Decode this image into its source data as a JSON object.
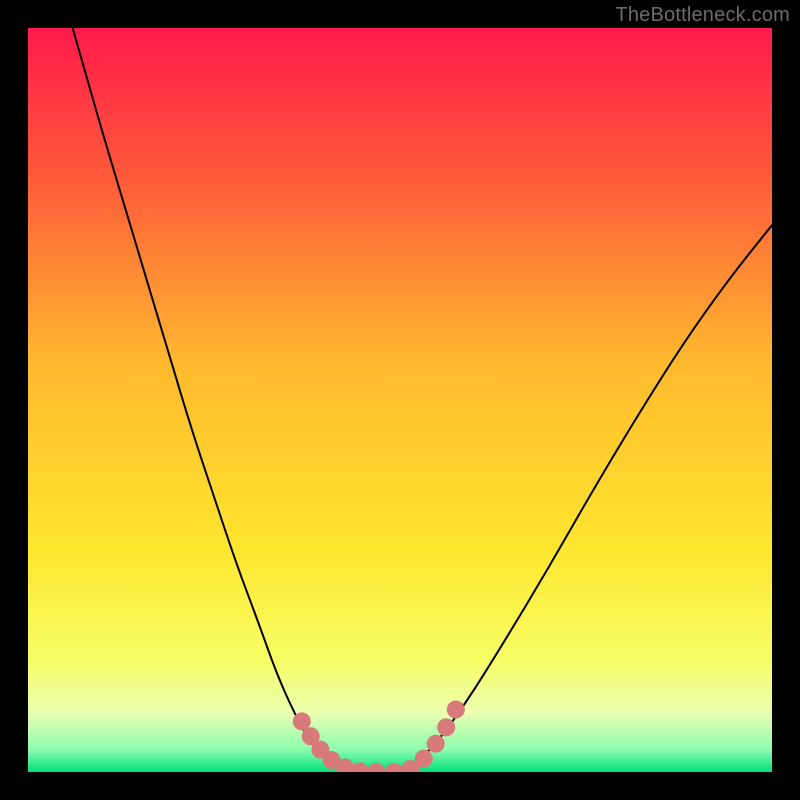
{
  "watermark": "TheBottleneck.com",
  "chart_data": {
    "type": "line",
    "title": "",
    "xlabel": "",
    "ylabel": "",
    "xlim": [
      0,
      1
    ],
    "ylim": [
      0,
      1
    ],
    "background_gradient": {
      "stops": [
        {
          "offset": 0.0,
          "color": "#ff1a4b"
        },
        {
          "offset": 0.2,
          "color": "#ff5a3a"
        },
        {
          "offset": 0.45,
          "color": "#ffb92e"
        },
        {
          "offset": 0.7,
          "color": "#ffe62e"
        },
        {
          "offset": 0.85,
          "color": "#f7ff66"
        },
        {
          "offset": 0.92,
          "color": "#eaffb0"
        },
        {
          "offset": 0.97,
          "color": "#8dfcae"
        },
        {
          "offset": 1.0,
          "color": "#00e07a"
        }
      ]
    },
    "series": [
      {
        "name": "left-curve",
        "stroke": "#000000",
        "stroke_width": 2,
        "points": [
          {
            "x": 0.06,
            "y": 1.0
          },
          {
            "x": 0.08,
            "y": 0.93
          },
          {
            "x": 0.1,
            "y": 0.86
          },
          {
            "x": 0.13,
            "y": 0.76
          },
          {
            "x": 0.16,
            "y": 0.66
          },
          {
            "x": 0.19,
            "y": 0.56
          },
          {
            "x": 0.22,
            "y": 0.46
          },
          {
            "x": 0.25,
            "y": 0.37
          },
          {
            "x": 0.28,
            "y": 0.28
          },
          {
            "x": 0.31,
            "y": 0.2
          },
          {
            "x": 0.335,
            "y": 0.13
          },
          {
            "x": 0.36,
            "y": 0.075
          },
          {
            "x": 0.38,
            "y": 0.04
          },
          {
            "x": 0.4,
            "y": 0.018
          },
          {
            "x": 0.42,
            "y": 0.006
          },
          {
            "x": 0.44,
            "y": 0.0
          }
        ]
      },
      {
        "name": "right-curve",
        "stroke": "#000000",
        "stroke_width": 2,
        "points": [
          {
            "x": 0.5,
            "y": 0.0
          },
          {
            "x": 0.52,
            "y": 0.01
          },
          {
            "x": 0.55,
            "y": 0.04
          },
          {
            "x": 0.59,
            "y": 0.095
          },
          {
            "x": 0.64,
            "y": 0.175
          },
          {
            "x": 0.7,
            "y": 0.275
          },
          {
            "x": 0.76,
            "y": 0.38
          },
          {
            "x": 0.82,
            "y": 0.48
          },
          {
            "x": 0.88,
            "y": 0.575
          },
          {
            "x": 0.94,
            "y": 0.66
          },
          {
            "x": 1.0,
            "y": 0.735
          }
        ]
      },
      {
        "name": "valley-floor",
        "stroke": "#000000",
        "stroke_width": 2,
        "points": [
          {
            "x": 0.44,
            "y": 0.0
          },
          {
            "x": 0.5,
            "y": 0.0
          }
        ]
      }
    ],
    "markers": [
      {
        "name": "left-dots",
        "color": "#d97a7a",
        "radius": 9,
        "points": [
          {
            "x": 0.368,
            "y": 0.068
          },
          {
            "x": 0.38,
            "y": 0.048
          },
          {
            "x": 0.393,
            "y": 0.03
          },
          {
            "x": 0.408,
            "y": 0.016
          },
          {
            "x": 0.426,
            "y": 0.006
          },
          {
            "x": 0.446,
            "y": 0.001
          },
          {
            "x": 0.468,
            "y": 0.0
          }
        ]
      },
      {
        "name": "right-dots",
        "color": "#d97a7a",
        "radius": 9,
        "points": [
          {
            "x": 0.492,
            "y": 0.0
          },
          {
            "x": 0.514,
            "y": 0.004
          },
          {
            "x": 0.532,
            "y": 0.018
          },
          {
            "x": 0.548,
            "y": 0.038
          },
          {
            "x": 0.562,
            "y": 0.06
          },
          {
            "x": 0.575,
            "y": 0.084
          }
        ]
      }
    ]
  }
}
